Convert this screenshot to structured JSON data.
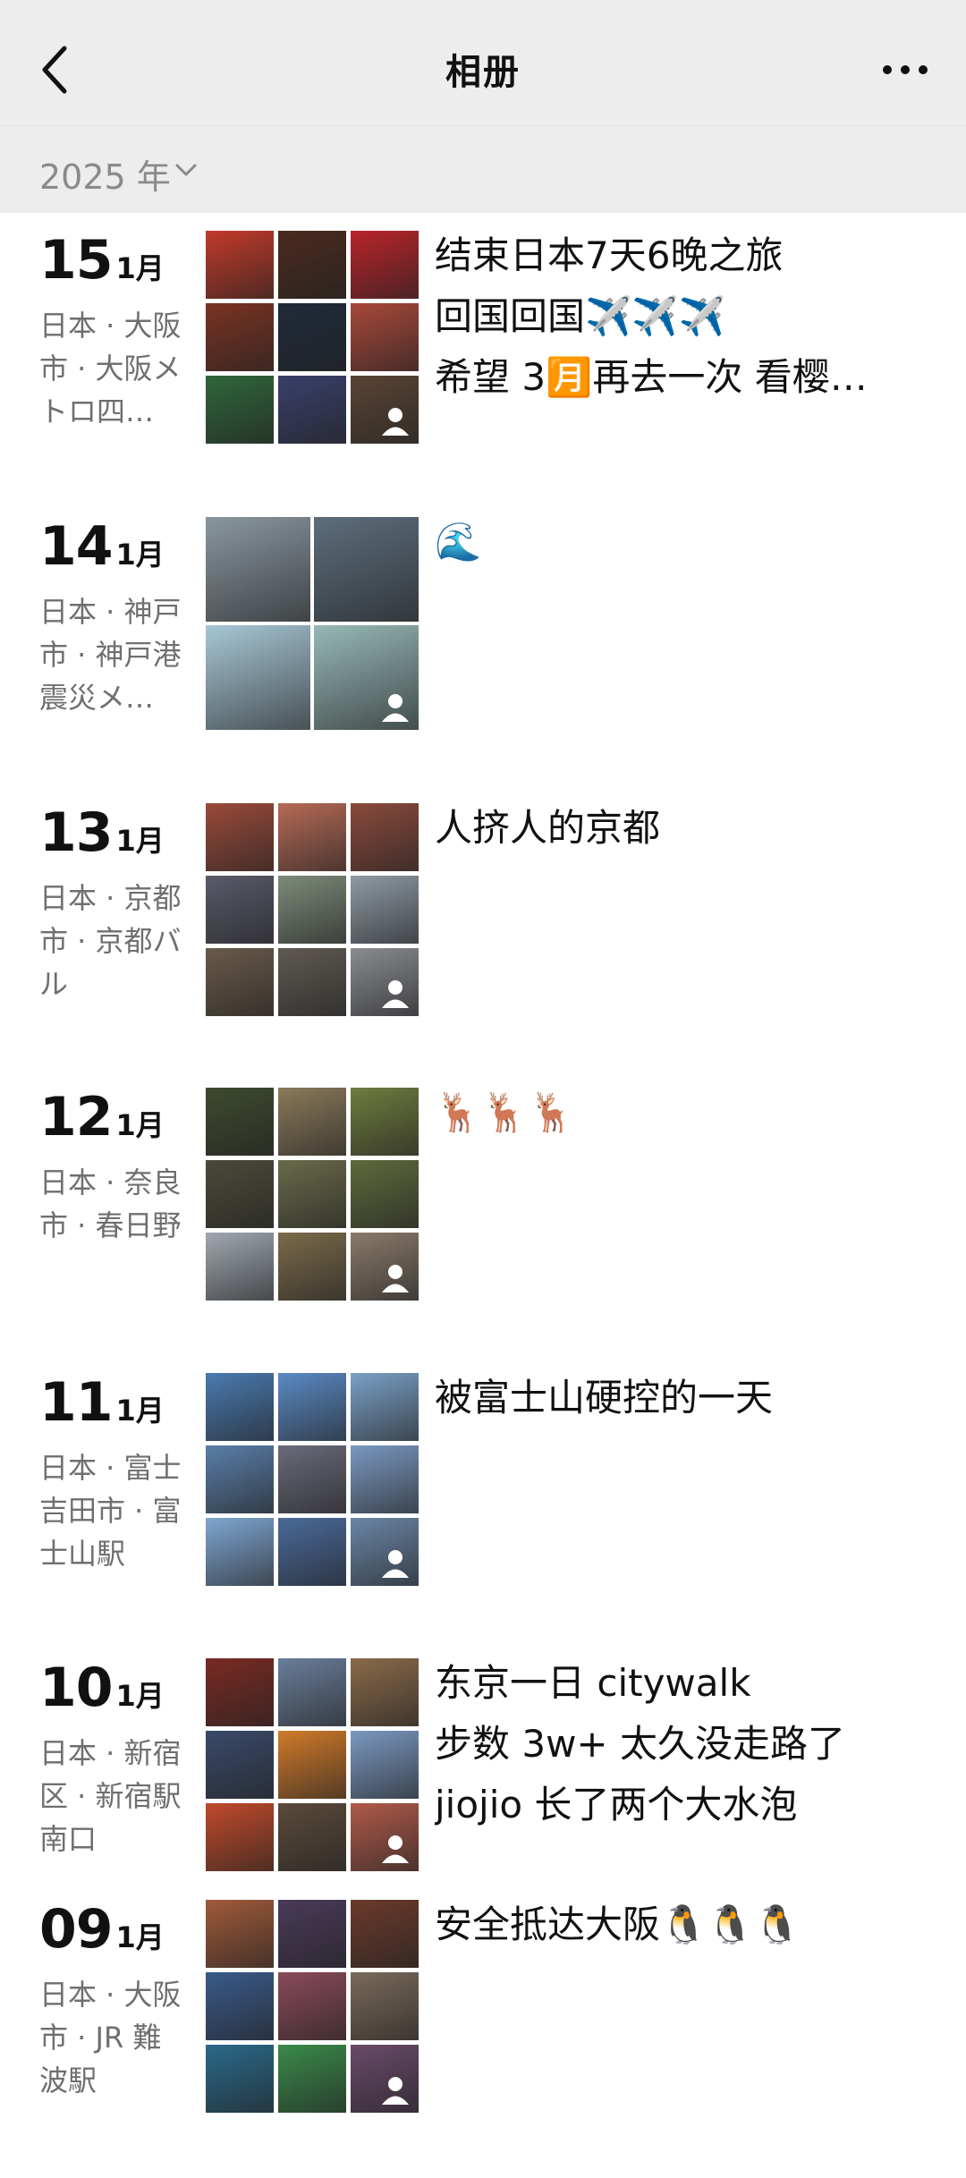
{
  "nav": {
    "title": "相册",
    "back_icon": "chevron-left-icon",
    "more_icon": "more-dots-icon"
  },
  "year_filter": {
    "label": "2025 年",
    "icon": "chevron-down-icon"
  },
  "entries": [
    {
      "day": "15",
      "month": "1月",
      "location": "日本 · 大阪市 · 大阪メトロ四…",
      "caption_lines": [
        "结束日本7天6晚之旅",
        "回国回国✈️✈️✈️",
        "希望 3🈷️再去一次 看樱…"
      ],
      "colors": [
        "#c23a2a",
        "#4a2a1e",
        "#b8242a",
        "#7a3322",
        "#1f2a3a",
        "#a8483a",
        "#30663a",
        "#3a3f6a",
        "#5a4434"
      ]
    },
    {
      "day": "14",
      "month": "1月",
      "location": "日本 · 神戸市 · 神戸港震災メ…",
      "caption_lines": [
        "🌊"
      ],
      "colors": [
        "#8a97a0",
        "#5d6e7c",
        "#a7c7d6",
        "#96b8b6"
      ]
    },
    {
      "day": "13",
      "month": "1月",
      "location": "日本 · 京都市 · 京都バル",
      "caption_lines": [
        "人挤人的京都"
      ],
      "colors": [
        "#9a4a3a",
        "#b66a56",
        "#8a4a3c",
        "#5a5a6a",
        "#7d8b7a",
        "#8f9aa4",
        "#6a5a4a",
        "#5f5a52",
        "#8a8c90"
      ]
    },
    {
      "day": "12",
      "month": "1月",
      "location": "日本 · 奈良市 · 春日野",
      "caption_lines": [
        "🦌🦌🦌"
      ],
      "colors": [
        "#3e4a2e",
        "#8a7a5a",
        "#6f7c3e",
        "#4a4a3a",
        "#6a6a4a",
        "#5f6a3c",
        "#a0a8b0",
        "#7a6a4a",
        "#8a7a6a"
      ]
    },
    {
      "day": "11",
      "month": "1月",
      "location": "日本 · 富士吉田市 · 富士山駅",
      "caption_lines": [
        "被富士山硬控的一天"
      ],
      "colors": [
        "#4a7ab0",
        "#5a8ac4",
        "#7aa0c6",
        "#5a7ea8",
        "#6a6a7a",
        "#7a98c0",
        "#7fa6d2",
        "#4a6a9a",
        "#6a86a6"
      ]
    },
    {
      "day": "10",
      "month": "1月",
      "location": "日本 · 新宿区 · 新宿駅 南口",
      "caption_lines": [
        "东京一日 citywalk",
        "步数 3w+  太久没走路了",
        "jiojio 长了两个大水泡"
      ],
      "colors": [
        "#7a2a22",
        "#6a7e9a",
        "#8a6a4a",
        "#3a4a6a",
        "#d07a2a",
        "#7a98c0",
        "#c04a2a",
        "#5a4a3a",
        "#b05a4a"
      ]
    },
    {
      "day": "09",
      "month": "1月",
      "location": "日本 · 大阪市 · JR 難波駅",
      "caption_lines": [
        "安全抵达大阪🐧🐧🐧"
      ],
      "colors": [
        "#a05a3a",
        "#4a3a5a",
        "#6a3a2a",
        "#3a5a8a",
        "#8a4a5a",
        "#7a6a5a",
        "#2a6a8a",
        "#3a8a4a",
        "#6a4a6a"
      ]
    }
  ]
}
